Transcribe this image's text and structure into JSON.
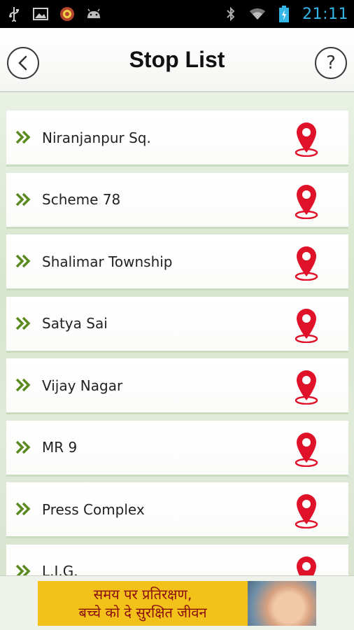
{
  "status_bar": {
    "time": "21:11",
    "left_icons": [
      "usb-icon",
      "image-icon",
      "app-badge-icon",
      "android-icon"
    ],
    "right_icons": [
      "bluetooth-icon",
      "wifi-icon",
      "battery-charging-icon"
    ],
    "time_color": "#33b5e5"
  },
  "header": {
    "title": "Stop List",
    "back_icon": "chevron-left-icon",
    "help_label": "?"
  },
  "stops": [
    {
      "name": "Niranjanpur Sq."
    },
    {
      "name": "Scheme 78"
    },
    {
      "name": "Shalimar Township"
    },
    {
      "name": "Satya Sai"
    },
    {
      "name": "Vijay Nagar"
    },
    {
      "name": "MR 9"
    },
    {
      "name": "Press Complex"
    },
    {
      "name": "L.I.G."
    }
  ],
  "colors": {
    "chevron": "#5a8a1f",
    "pin": "#e0122a"
  },
  "banner": {
    "line1": "समय पर प्रतिरक्षण,",
    "line2": "बच्चे को दे सुरक्षित जीवन",
    "background": "#f2c21b"
  }
}
